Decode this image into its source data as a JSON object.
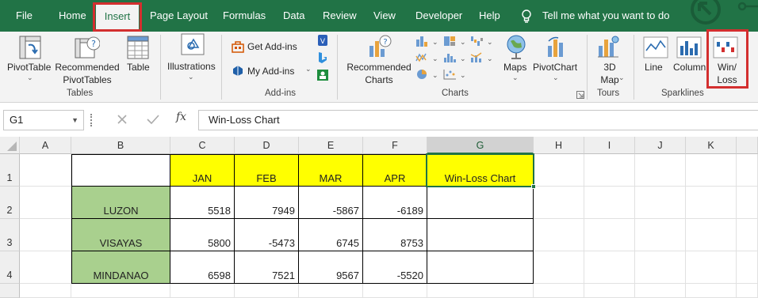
{
  "tabs": [
    "File",
    "Home",
    "Insert",
    "Page Layout",
    "Formulas",
    "Data",
    "Review",
    "View",
    "Developer",
    "Help"
  ],
  "tell_me": "Tell me what you want to do",
  "ribbon": {
    "pivottable": "PivotTable",
    "rec_pivot_1": "Recommended",
    "rec_pivot_2": "PivotTables",
    "table": "Table",
    "illustrations": "Illustrations",
    "get_addins": "Get Add-ins",
    "my_addins": "My Add-ins",
    "rec_charts_1": "Recommended",
    "rec_charts_2": "Charts",
    "maps": "Maps",
    "pivotchart": "PivotChart",
    "map3d_1": "3D",
    "map3d_2": "Map",
    "line": "Line",
    "column": "Column",
    "winloss_1": "Win/",
    "winloss_2": "Loss",
    "groups": {
      "tables": "Tables",
      "addins": "Add-ins",
      "charts": "Charts",
      "tours": "Tours",
      "sparklines": "Sparklines"
    }
  },
  "formula_bar": {
    "name_box": "G1",
    "fx": "fx",
    "value": "Win-Loss Chart"
  },
  "sheet": {
    "columns": [
      "A",
      "B",
      "C",
      "D",
      "E",
      "F",
      "G",
      "H",
      "I",
      "J",
      "K"
    ],
    "rows": [
      "1",
      "2",
      "3",
      "4"
    ],
    "headers": [
      "JAN",
      "FEB",
      "MAR",
      "APR",
      "Win-Loss Chart"
    ],
    "regions": [
      {
        "name": "LUZON",
        "values": [
          "5518",
          "7949",
          "-5867",
          "-6189"
        ]
      },
      {
        "name": "VISAYAS",
        "values": [
          "5800",
          "-5473",
          "6745",
          "8753"
        ]
      },
      {
        "name": "MINDANAO",
        "values": [
          "6598",
          "7521",
          "9567",
          "-5520"
        ]
      }
    ]
  },
  "colors": {
    "excel_green": "#217346",
    "highlight_yellow": "#ffff00",
    "region_green": "#a9d08e",
    "callout_red": "#d32f2f"
  }
}
